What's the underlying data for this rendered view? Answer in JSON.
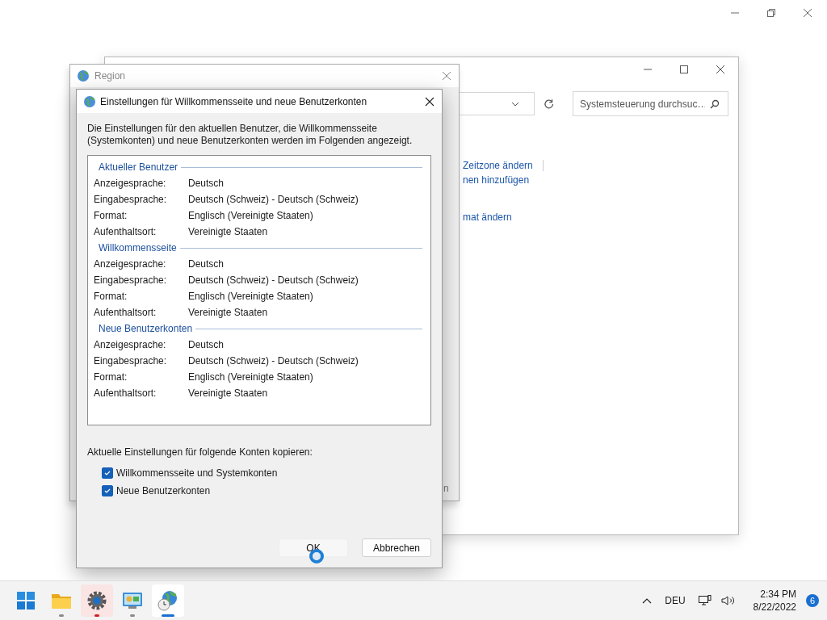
{
  "control_panel": {
    "search": {
      "placeholder": "Systemsteuerung durchsuc…"
    },
    "links": [
      "Zeitzone ändern",
      "nen hinzufügen",
      "mat ändern"
    ]
  },
  "region_window": {
    "title": "Region",
    "button_fragment": "n"
  },
  "dialog": {
    "title": "Einstellungen für Willkommensseite und neue Benutzerkonten",
    "intro": "Die Einstellungen für den aktuellen Benutzer, die Willkommensseite (Systemkonten) und neue Benutzerkonten werden im Folgenden angezeigt.",
    "sections": [
      {
        "heading": "Aktueller Benutzer",
        "rows": [
          {
            "label": "Anzeigesprache:",
            "value": "Deutsch"
          },
          {
            "label": "Eingabesprache:",
            "value": "Deutsch (Schweiz) - Deutsch (Schweiz)"
          },
          {
            "label": "Format:",
            "value": "Englisch (Vereinigte Staaten)"
          },
          {
            "label": "Aufenthaltsort:",
            "value": "Vereinigte Staaten"
          }
        ]
      },
      {
        "heading": "Willkommensseite",
        "rows": [
          {
            "label": "Anzeigesprache:",
            "value": "Deutsch"
          },
          {
            "label": "Eingabesprache:",
            "value": "Deutsch (Schweiz) - Deutsch (Schweiz)"
          },
          {
            "label": "Format:",
            "value": "Englisch (Vereinigte Staaten)"
          },
          {
            "label": "Aufenthaltsort:",
            "value": "Vereinigte Staaten"
          }
        ]
      },
      {
        "heading": "Neue Benutzerkonten",
        "rows": [
          {
            "label": "Anzeigesprache:",
            "value": "Deutsch"
          },
          {
            "label": "Eingabesprache:",
            "value": "Deutsch (Schweiz) - Deutsch (Schweiz)"
          },
          {
            "label": "Format:",
            "value": "Englisch (Vereinigte Staaten)"
          },
          {
            "label": "Aufenthaltsort:",
            "value": "Vereinigte Staaten"
          }
        ]
      }
    ],
    "copy_label": "Aktuelle Einstellungen für folgende Konten kopieren:",
    "checkboxes": [
      {
        "label": "Willkommensseite und Systemkonten",
        "checked": true
      },
      {
        "label": "Neue Benutzerkonten",
        "checked": true
      }
    ],
    "buttons": [
      {
        "label": "OK",
        "kind": "ok"
      },
      {
        "label": "Abbrechen",
        "kind": "cancel"
      }
    ]
  },
  "taskbar": {
    "apps": [
      {
        "kind": "folder",
        "alert": false,
        "selected": false
      },
      {
        "kind": "gear",
        "alert": true,
        "selected": false
      },
      {
        "kind": "panel",
        "alert": false,
        "selected": false
      },
      {
        "kind": "globe",
        "alert": false,
        "selected": true
      }
    ],
    "language": "DEU",
    "time": "2:34 PM",
    "date": "8/22/2022",
    "notifications": "6"
  }
}
